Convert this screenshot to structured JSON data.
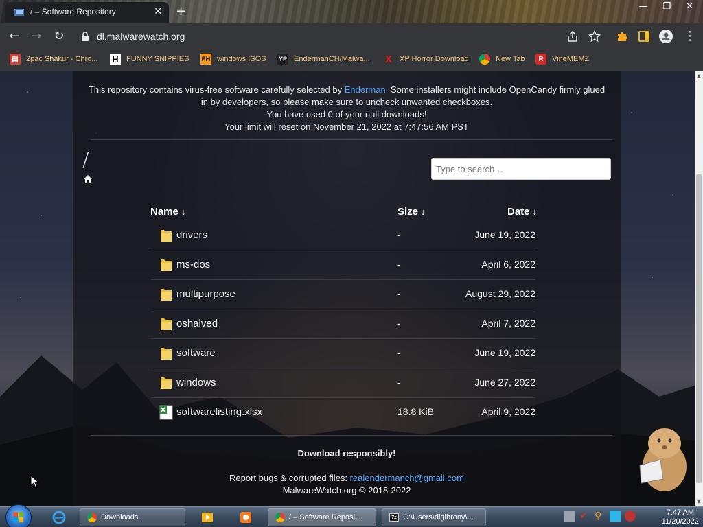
{
  "browser": {
    "tab_title": "/ – Software Repository",
    "url": "dl.malwarewatch.org"
  },
  "bookmarks": [
    {
      "label": "2pac Shakur - Chro...",
      "icon": "archive-icon"
    },
    {
      "label": "FUNNY SNIPPIES",
      "icon": "h-logo-icon"
    },
    {
      "label": "windows ISOS",
      "icon": "ph-logo-icon"
    },
    {
      "label": "EndermanCH/Malwa...",
      "icon": "yp-logo-icon"
    },
    {
      "label": "XP Horror Download",
      "icon": "x-logo-icon"
    },
    {
      "label": "New Tab",
      "icon": "chrome-logo-icon"
    },
    {
      "label": "VineMEMZ",
      "icon": "r-logo-icon"
    }
  ],
  "page": {
    "intro_before": "This repository contains virus-free software carefully selected by ",
    "intro_link": "Enderman",
    "intro_after": ". Some installers might include OpenCandy firmly glued in by developers, so please make sure to uncheck unwanted checkboxes.",
    "downloads_used": "You have used 0 of your null downloads!",
    "limit_reset": "Your limit will reset on November 21, 2022 at 7:47:56 AM PST",
    "breadcrumb": "/",
    "search_placeholder": "Type to search…",
    "columns": {
      "name": "Name",
      "size": "Size",
      "date": "Date",
      "arrow": "↓"
    },
    "files": [
      {
        "name": "drivers",
        "size": "-",
        "date": "June 19, 2022",
        "type": "folder"
      },
      {
        "name": "ms-dos",
        "size": "-",
        "date": "April 6, 2022",
        "type": "folder"
      },
      {
        "name": "multipurpose",
        "size": "-",
        "date": "August 29, 2022",
        "type": "folder"
      },
      {
        "name": "oshalved",
        "size": "-",
        "date": "April 7, 2022",
        "type": "folder"
      },
      {
        "name": "software",
        "size": "-",
        "date": "June 19, 2022",
        "type": "folder"
      },
      {
        "name": "windows",
        "size": "-",
        "date": "June 27, 2022",
        "type": "folder"
      },
      {
        "name": "softwarelisting.xlsx",
        "size": "18.8 KiB",
        "date": "April 9, 2022",
        "type": "xlsx"
      }
    ],
    "footer_notice": "Download responsibly!",
    "report_label": "Report bugs & corrupted files: ",
    "report_email": "realendermanch@gmail.com",
    "copyright": "MalwareWatch.org © 2018-2022"
  },
  "taskbar": {
    "tasks": [
      {
        "label": "Downloads"
      },
      {
        "label": "/ – Software Reposi..."
      },
      {
        "label": "C:\\Users\\digibrony\\..."
      }
    ],
    "time": "7:47 AM",
    "date": "11/20/2022"
  },
  "colors": {
    "link": "#4ea3ff",
    "bookmark_text": "#f2c57c",
    "folder": "#e8c04a",
    "xlsx": "#2e8b3e"
  }
}
